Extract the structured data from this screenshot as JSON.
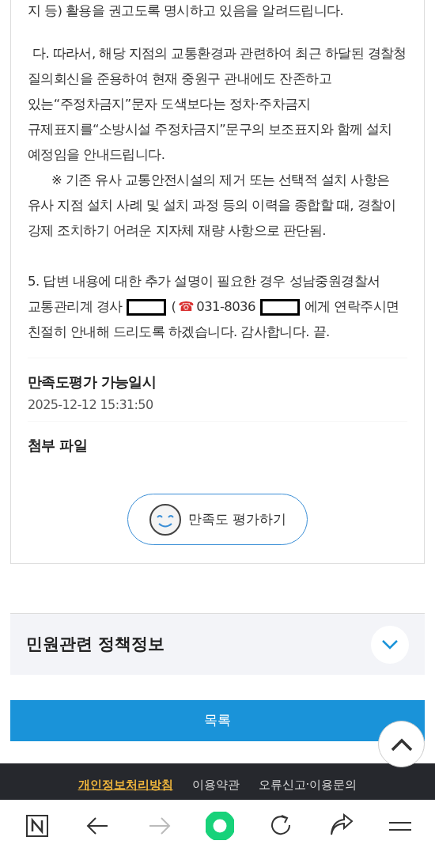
{
  "answer_paragraphs": [
    {
      "kind": "plain",
      "text": "지 등) 활용을 권고도록 명시하고 있음을 알려드립니다."
    },
    {
      "kind": "indented",
      "text": "다. 따라서, 해당 지점의 교통환경과 관련하여 최근 하달된 경찰청 질의회신을 준용하여 현재 중원구 관내에도 잔존하고 있는“주정차금지”문자 도색보다는 정차·주차금지 규제표지를“소방시설 주정차금지”문구의 보조표지와 함께 설치 예정임을 안내드립니다."
    },
    {
      "kind": "note",
      "text": "※ 기존 유사 교통안전시설의 제거 또는 선택적 설치 사항은 유사 지점 설치 사례 및 설치 과정 등의 이력을 종합할 때, 경찰이 강제 조치하기 어려운 지자체 재량 사항으로 판단됨."
    }
  ],
  "contact_paragraph": [
    [
      {
        "kind": "text",
        "text": "5. 답변 내용에 대한 추가 설명이 필요한 경우 성남중원경찰서"
      }
    ],
    [
      {
        "kind": "text",
        "text": "교통관리계 경사"
      },
      {
        "kind": "redacted"
      },
      {
        "kind": "text",
        "text": "("
      },
      {
        "kind": "phone",
        "text": "☎"
      },
      {
        "kind": "text",
        "text": "031-8036"
      },
      {
        "kind": "redacted"
      },
      {
        "kind": "text",
        "text": "에게 연락주시면"
      }
    ],
    [
      {
        "kind": "text",
        "text": "친절히 안내해 드리도록 하겠습니다. 감사합니다.  끝."
      }
    ]
  ],
  "satisfaction_date": {
    "label": "만족도평가 가능일시",
    "value": "2025-12-12 15:31:50"
  },
  "attachments": {
    "label": "첨부 파일"
  },
  "rate_button": {
    "label": "만족도 평가하기"
  },
  "policy_panel": {
    "title": "민원관련 정책정보",
    "expanded": false
  },
  "list_button": {
    "label": "목록"
  },
  "footer_links": [
    {
      "label": "개인정보처리방침",
      "highlighted": true
    },
    {
      "label": "이용약관",
      "highlighted": false
    },
    {
      "label": "오류신고·이용문의",
      "highlighted": false
    }
  ],
  "browser_toolbar": [
    {
      "kind": "home",
      "disabled": false
    },
    {
      "kind": "back",
      "disabled": false
    },
    {
      "kind": "forward",
      "disabled": true
    },
    {
      "kind": "green",
      "disabled": false
    },
    {
      "kind": "reload",
      "disabled": false
    },
    {
      "kind": "share",
      "disabled": false
    },
    {
      "kind": "menu",
      "disabled": false
    }
  ]
}
